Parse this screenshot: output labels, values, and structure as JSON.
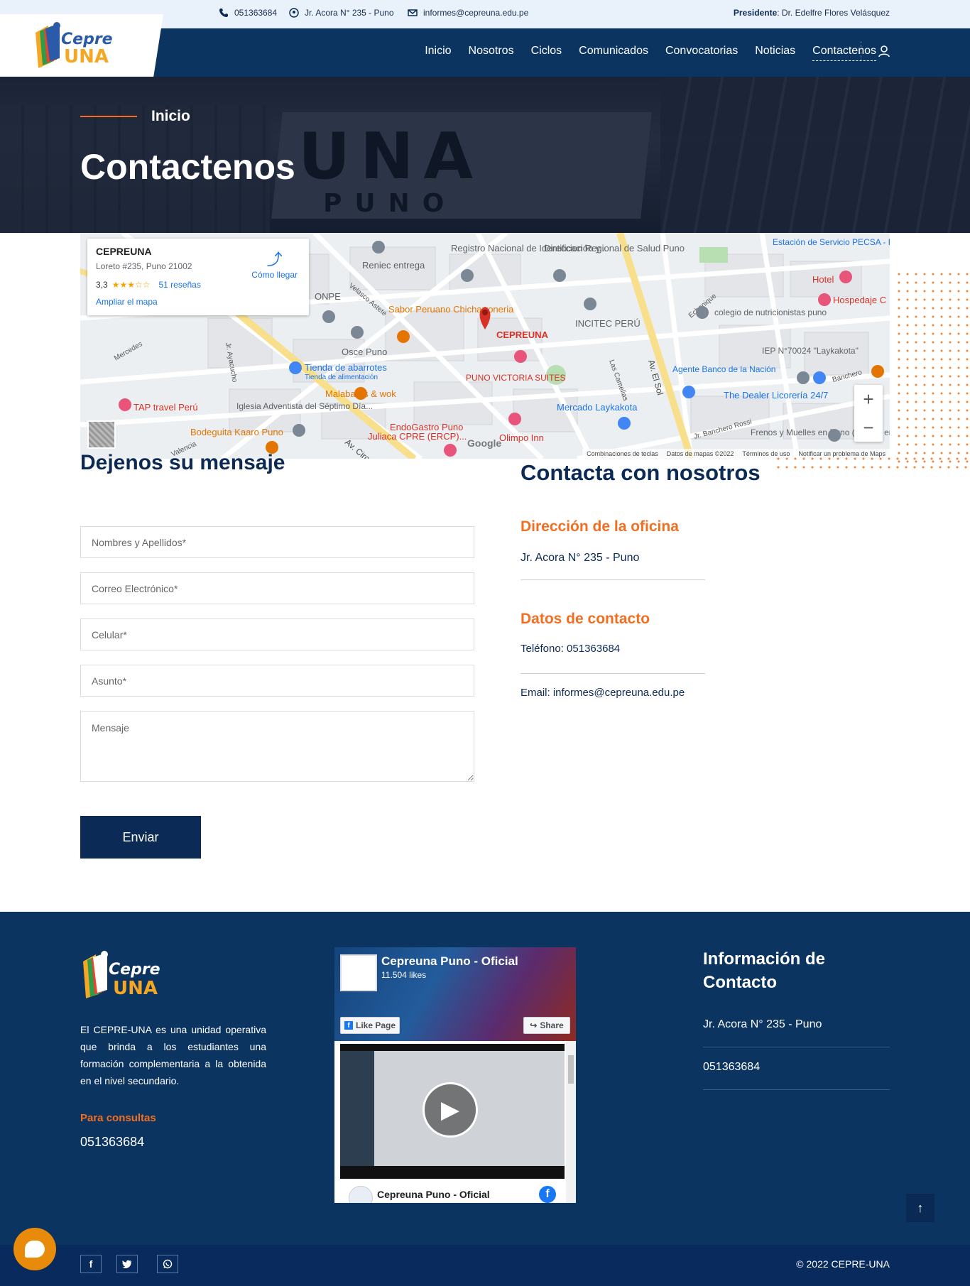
{
  "topbar": {
    "phone": "051363684",
    "address": "Jr. Acora N° 235 - Puno",
    "email": "informes@cepreuna.edu.pe",
    "president_label": "Presidente",
    "president_name": ": Dr. Edelfre Flores Velásquez"
  },
  "brand": {
    "logo_top": "Cepre",
    "logo_bottom": "UNA",
    "accent": "#f26f21",
    "navy": "#0b3460"
  },
  "nav": {
    "items": [
      {
        "label": "Inicio"
      },
      {
        "label": "Nosotros"
      },
      {
        "label": "Ciclos"
      },
      {
        "label": "Comunicados"
      },
      {
        "label": "Convocatorias"
      },
      {
        "label": "Noticias"
      },
      {
        "label": "Contactenos"
      }
    ],
    "active": "Contactenos"
  },
  "hero": {
    "breadcrumb": "Inicio",
    "title": "Contactenos",
    "sign_big": "UNA",
    "sign_small": "PUNO"
  },
  "map": {
    "place_name": "CEPREUNA",
    "place_address": "Loreto #235, Puno 21002",
    "rating": "3,3",
    "reviews": "51 reseñas",
    "enlarge": "Ampliar el mapa",
    "directions": "Cómo llegar",
    "labels": [
      "Registro Nacional de Identificación y...",
      "Direccion Regional de Salud Puno",
      "Estación de Servicio PECSA - Porteño",
      "Reniec entrega",
      "ONPE",
      "Sabor Peruano Chicharroneria",
      "CEPREUNA",
      "INCITEC PERÚ",
      "colegio de nutricionistas puno",
      "Hotel",
      "Hospedaje C",
      "Osce Puno",
      "Tienda de abarrotes",
      "Tienda de alimentación",
      "PUNO VICTORIA SUITES",
      "Agente Banco de la Nación",
      "IEP N°70024 \"Laykakota\"",
      "TAP travel Perú",
      "Iglesia Adventista del Séptimo Día...",
      "Malabares & wok",
      "Mercado Laykakota",
      "The Dealer Licorería 24/7",
      "Bodeguita Kaaro Puno",
      "EndoGastro Puno",
      "Juliaca CPRE (ERCP)...",
      "Olimpo Inn",
      "Frenos y Muelles en Puno (técnico en...",
      "Av. El Sol",
      "Av. Circu",
      "Mercedes",
      "Valencia",
      "Banchero",
      "Jr. Banchero Rossi",
      "Echenique",
      "Las Camelias",
      "Jr. Ayacucho",
      "Velasco Astete"
    ],
    "footer": [
      "Combinaciones de teclas",
      "Datos de mapas ©2022",
      "Términos de uso",
      "Notificar un problema de Maps"
    ],
    "google": "Google"
  },
  "form": {
    "title": "Dejenos su mensaje",
    "name_placeholder": "Nombres y Apellidos*",
    "email_placeholder": "Correo Electrónico*",
    "phone_placeholder": "Celular*",
    "subject_placeholder": "Asunto*",
    "message_placeholder": "Mensaje",
    "submit": "Enviar"
  },
  "contact": {
    "title": "Contacta con nosotros",
    "office_title": "Dirección de la oficina",
    "office_address": "Jr. Acora N° 235 - Puno",
    "data_title": "Datos de contacto",
    "phone": "Teléfono: 051363684",
    "email": "Email: informes@cepreuna.edu.pe"
  },
  "footer": {
    "about": "El CEPRE-UNA es una unidad operativa que brinda a los estudiantes una formación complementaria a la obtenida en el nivel secundario.",
    "consult_label": "Para consultas",
    "consult_phone": "051363684",
    "fb": {
      "page_name": "Cepreuna Puno - Oficial",
      "likes": "11.504 likes",
      "like_btn": "Like Page",
      "share_btn": "Share",
      "post_name": "Cepreuna Puno - Oficial"
    },
    "info_title": "Información de Contacto",
    "info_address": "Jr. Acora N° 235 - Puno",
    "info_phone": "051363684",
    "copyright": "© 2022 CEPRE-UNA",
    "social": [
      "facebook",
      "twitter",
      "whatsapp"
    ]
  }
}
